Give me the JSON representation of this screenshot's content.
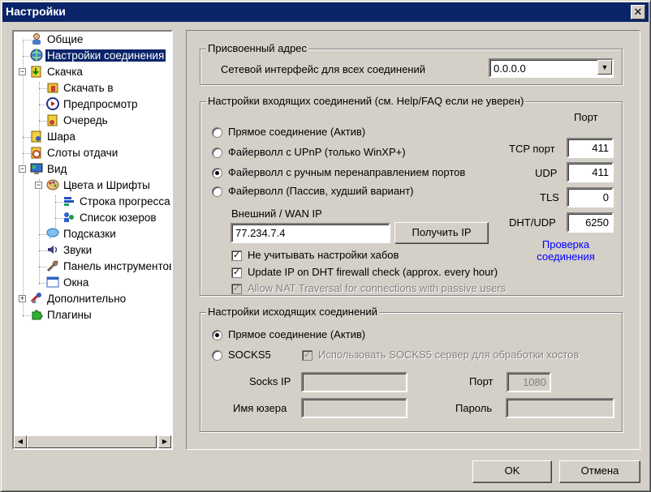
{
  "window": {
    "title": "Настройки",
    "close": "✕"
  },
  "tree": {
    "items": [
      {
        "label": "Общие"
      },
      {
        "label": "Настройки соединения"
      },
      {
        "label": "Скачка"
      },
      {
        "label": "Скачать в"
      },
      {
        "label": "Предпросмотр"
      },
      {
        "label": "Очередь"
      },
      {
        "label": "Шара"
      },
      {
        "label": "Слоты отдачи"
      },
      {
        "label": "Вид"
      },
      {
        "label": "Цвета и Шрифты"
      },
      {
        "label": "Строка прогресса"
      },
      {
        "label": "Список юзеров"
      },
      {
        "label": "Подсказки"
      },
      {
        "label": "Звуки"
      },
      {
        "label": "Панель инструментов"
      },
      {
        "label": "Окна"
      },
      {
        "label": "Дополнительно"
      },
      {
        "label": "Плагины"
      }
    ],
    "expand_minus": "−",
    "expand_plus": "+",
    "scroll_left": "◀",
    "scroll_right": "▶"
  },
  "assigned": {
    "title": "Присвоенный адрес",
    "interface_label": "Сетевой интерфейс для всех соединений",
    "interface_value": "0.0.0.0",
    "arrow": "▼"
  },
  "incoming": {
    "title": "Настройки входящих соединений (см. Help/FAQ если не уверен)",
    "port_header": "Порт",
    "options": [
      {
        "label": "Прямое соединение (Актив)",
        "selected": false
      },
      {
        "label": "Файерволл с UPnP (только WinXP+)",
        "selected": false
      },
      {
        "label": "Файерволл с ручным перенаправлением портов",
        "selected": true
      },
      {
        "label": "Файерволл (Пассив, худший вариант)",
        "selected": false
      }
    ],
    "wan_label": "Внешний / WAN IP",
    "wan_value": "77.234.7.4",
    "get_ip": "Получить IP",
    "ports": {
      "tcp_label": "TCP порт",
      "tcp_value": "411",
      "udp_label": "UDP",
      "udp_value": "411",
      "tls_label": "TLS",
      "tls_value": "0",
      "dht_label": "DHT/UDP",
      "dht_value": "6250"
    },
    "check_link_line1": "Проверка",
    "check_link_line2": "соединения",
    "checks": [
      {
        "label": "Не учитывать настройки хабов",
        "checked": true,
        "mark": "✓"
      },
      {
        "label": "Update IP on DHT firewall check (approx. every hour)",
        "checked": true,
        "mark": "✓"
      },
      {
        "label": "Allow NAT Traversal for connections with passive users",
        "checked": true,
        "mark": "✓"
      }
    ]
  },
  "outgoing": {
    "title": "Настройки исходящих соединений",
    "direct": "Прямое соединение (Актив)",
    "socks5": "SOCKS5",
    "socks_hosts": "Использовать SOCKS5 сервер для обработки хостов",
    "socks_hosts_mark": "✓",
    "socks_ip_label": "Socks IP",
    "port_label": "Порт",
    "port_value": "1080",
    "user_label": "Имя юзера",
    "pass_label": "Пароль"
  },
  "buttons": {
    "ok": "OK",
    "cancel": "Отмена"
  }
}
